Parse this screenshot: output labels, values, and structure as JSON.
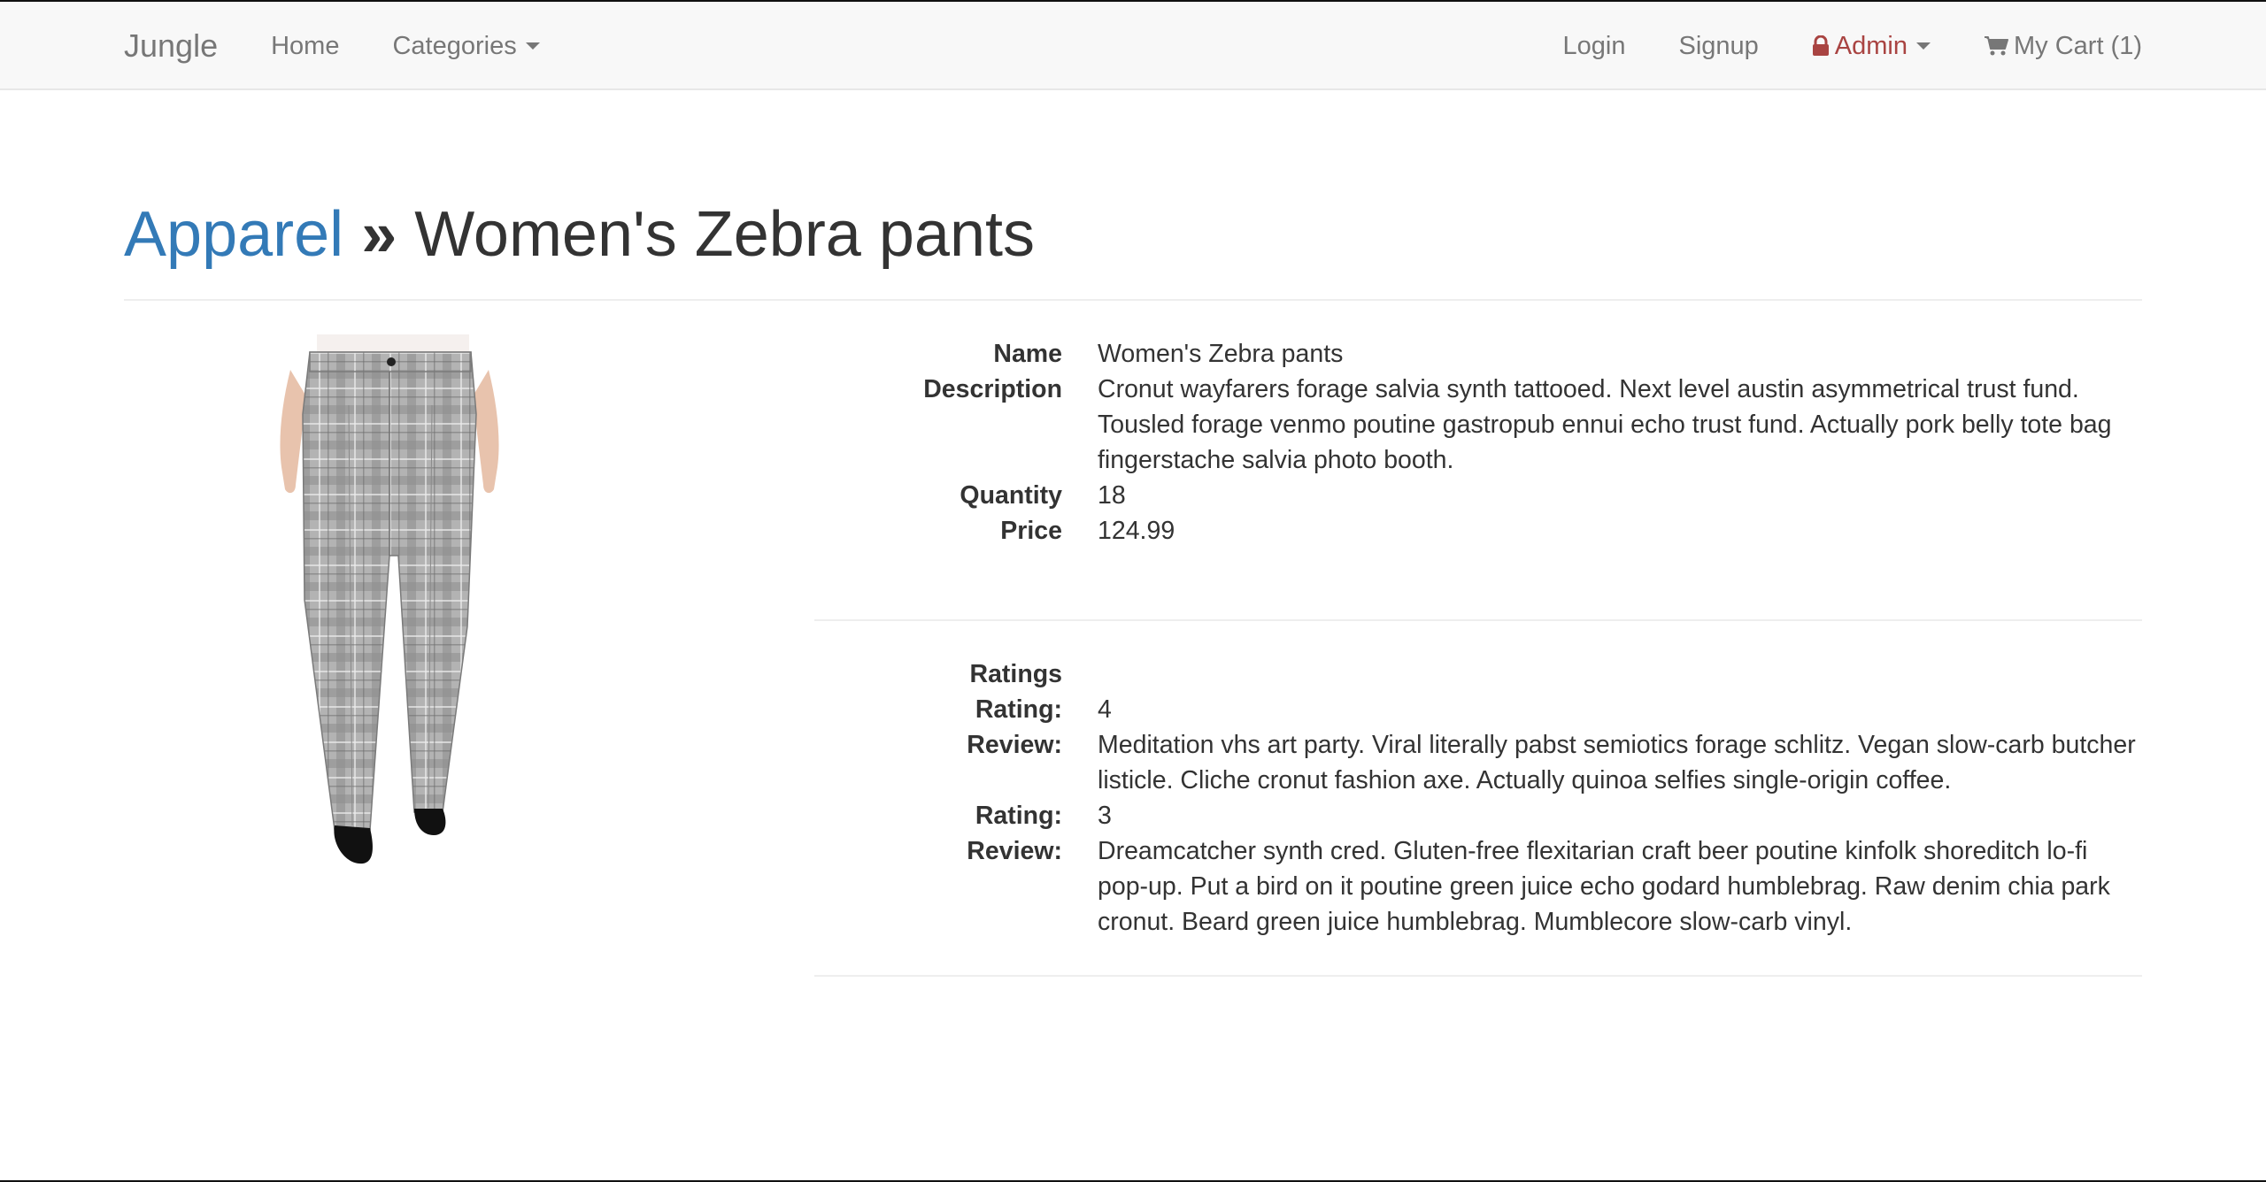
{
  "navbar": {
    "brand": "Jungle",
    "home": "Home",
    "categories": "Categories",
    "login": "Login",
    "signup": "Signup",
    "admin": "Admin",
    "cart": "My Cart (1)",
    "admin_color": "#a94442"
  },
  "header": {
    "category": "Apparel",
    "separator": "»",
    "product": "Women's Zebra pants"
  },
  "product": {
    "name_label": "Name",
    "name": "Women's Zebra pants",
    "description_label": "Description",
    "description": "Cronut wayfarers forage salvia synth tattooed. Next level austin asymmetrical trust fund. Tousled forage venmo poutine gastropub ennui echo trust fund. Actually pork belly tote bag fingerstache salvia photo booth.",
    "quantity_label": "Quantity",
    "quantity": "18",
    "price_label": "Price",
    "price": "124.99"
  },
  "ratings": {
    "heading": "Ratings",
    "items": [
      {
        "rating_label": "Rating:",
        "rating": "4",
        "review_label": "Review:",
        "review": "Meditation vhs art party. Viral literally pabst semiotics forage schlitz. Vegan slow-carb butcher listicle. Cliche cronut fashion axe. Actually quinoa selfies single-origin coffee."
      },
      {
        "rating_label": "Rating:",
        "rating": "3",
        "review_label": "Review:",
        "review": "Dreamcatcher synth cred. Gluten-free flexitarian craft beer poutine kinfolk shoreditch lo-fi pop-up. Put a bird on it poutine green juice echo godard humblebrag. Raw denim chia park cronut. Beard green juice humblebrag. Mumblecore slow-carb vinyl."
      }
    ]
  },
  "icons": {
    "lock": "lock-icon",
    "cart": "shopping-cart-icon",
    "caret": "chevron-down-icon"
  }
}
